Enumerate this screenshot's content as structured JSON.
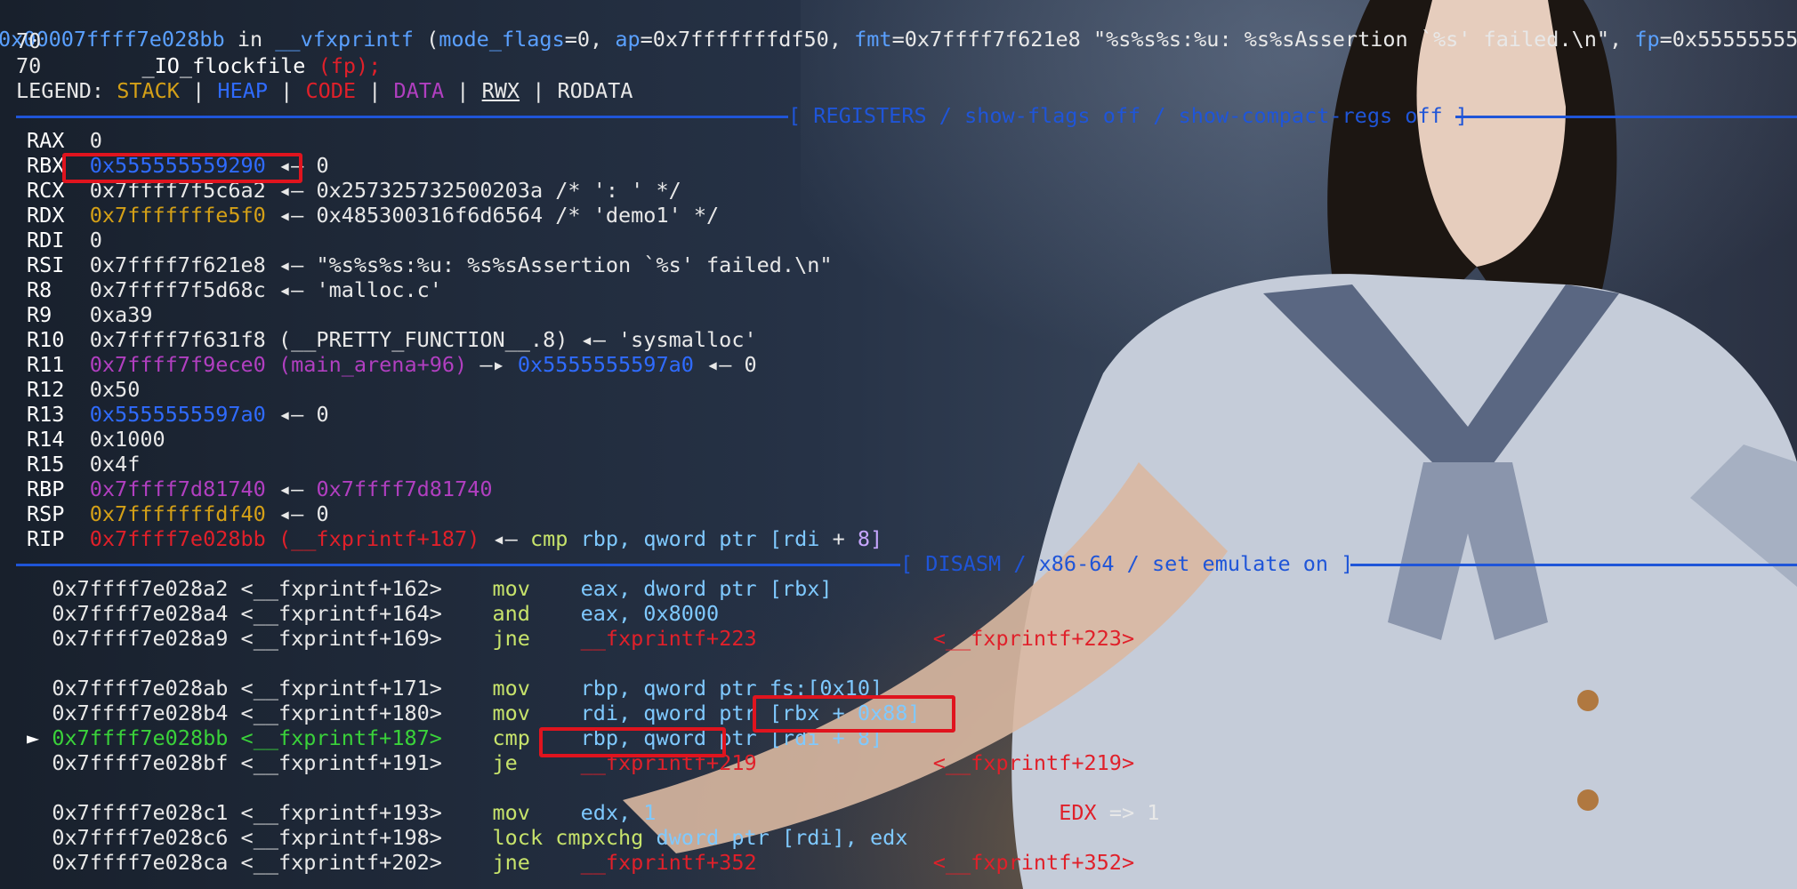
{
  "frame": {
    "addr": "0x00007ffff7e028bb",
    "in_word": "in",
    "func": "__vfxprintf",
    "args_open": "(",
    "arg1_name": "mode_flags",
    "arg1_val": "=0, ",
    "arg2_name": "ap",
    "arg2_val": "=0x7fffffffdf50, ",
    "arg3_name": "fmt",
    "arg3_val": "=0x7ffff7f621e8 \"%s%s%s:%u: %s%sAssertion `%s' failed.\\n\", ",
    "arg4_name": "fp",
    "arg4_val": "=0x55555555"
  },
  "source": {
    "line1": "70",
    "line2_no": "70",
    "line2_code": "_IO_flockfile",
    "line2_args": "(fp);"
  },
  "legend": {
    "label": "LEGEND:",
    "stack": "STACK",
    "heap": "HEAP",
    "code": "CODE",
    "data": "DATA",
    "rwx": "RWX",
    "rodata": "RODATA",
    "bar": "|"
  },
  "headers": {
    "registers": "[ REGISTERS / show-flags off / show-compact-regs off ]",
    "disasm": "[ DISASM / x86-64 / set emulate on ]"
  },
  "registers": [
    {
      "name": "RAX",
      "v1": "0",
      "arrow": "",
      "v2": ""
    },
    {
      "name": "RBX",
      "v1": "0x555555559290",
      "arrow": "◂—",
      "v2": "0"
    },
    {
      "name": "RCX",
      "v1": "0x7ffff7f5c6a2",
      "arrow": "◂—",
      "v2": "0x257325732500203a /* ': ' */"
    },
    {
      "name": "RDX",
      "v1": "0x7fffffffe5f0",
      "arrow": "◂—",
      "v2": "0x485300316f6d6564 /* 'demo1' */"
    },
    {
      "name": "RDI",
      "v1": "0",
      "arrow": "",
      "v2": ""
    },
    {
      "name": "RSI",
      "v1": "0x7ffff7f621e8",
      "arrow": "◂—",
      "v2": "\"%s%s%s:%u: %s%sAssertion `%s' failed.\\n\""
    },
    {
      "name": "R8",
      "v1": "0x7ffff7f5d68c",
      "arrow": "◂—",
      "v2": "'malloc.c'"
    },
    {
      "name": "R9",
      "v1": "0xa39",
      "arrow": "",
      "v2": ""
    },
    {
      "name": "R10",
      "v1": "0x7ffff7f631f8 (__PRETTY_FUNCTION__.8)",
      "arrow": "◂—",
      "v2": "'sysmalloc'"
    },
    {
      "name": "R11",
      "v1": "0x7ffff7f9ece0 (main_arena+96)",
      "arrow": "—▸",
      "v2": "0x5555555597a0",
      "arrow2": "◂—",
      "v3": "0"
    },
    {
      "name": "R12",
      "v1": "0x50",
      "arrow": "",
      "v2": ""
    },
    {
      "name": "R13",
      "v1": "0x5555555597a0",
      "arrow": "◂—",
      "v2": "0"
    },
    {
      "name": "R14",
      "v1": "0x1000",
      "arrow": "",
      "v2": ""
    },
    {
      "name": "R15",
      "v1": "0x4f",
      "arrow": "",
      "v2": ""
    },
    {
      "name": "RBP",
      "v1": "0x7ffff7d81740",
      "arrow": "◂—",
      "v2": "0x7ffff7d81740"
    },
    {
      "name": "RSP",
      "v1": "0x7fffffffdf40",
      "arrow": "◂—",
      "v2": "0"
    },
    {
      "name": "RIP",
      "v1": "0x7ffff7e028bb (__fxprintf+187)",
      "arrow": "◂—",
      "v2": "cmp",
      "v3": "rbp,",
      "v4": "qword ptr",
      "v5": "[rdi",
      "v6": "+",
      "v7": "8]"
    }
  ],
  "disasm": [
    {
      "addr": "0x7ffff7e028a2",
      "sym": "<__fxprintf+162>",
      "mnem": "mov",
      "ops": "eax, dword ptr [rbx]"
    },
    {
      "addr": "0x7ffff7e028a4",
      "sym": "<__fxprintf+164>",
      "mnem": "and",
      "ops": "eax, 0x8000"
    },
    {
      "addr": "0x7ffff7e028a9",
      "sym": "<__fxprintf+169>",
      "mnem": "jne",
      "ops": "__fxprintf+223",
      "target": "<__fxprintf+223>"
    },
    {
      "addr": "0x7ffff7e028ab",
      "sym": "<__fxprintf+171>",
      "mnem": "mov",
      "ops": "rbp, qword ptr fs:[0x10]"
    },
    {
      "addr": "0x7ffff7e028b4",
      "sym": "<__fxprintf+180>",
      "mnem": "mov",
      "ops": "rdi, qword ptr [rbx + 0x88]"
    },
    {
      "addr": "0x7ffff7e028bb",
      "sym": "<__fxprintf+187>",
      "mnem": "cmp",
      "ops": "rbp, qword ptr [rdi + 8]",
      "marker": "►"
    },
    {
      "addr": "0x7ffff7e028bf",
      "sym": "<__fxprintf+191>",
      "mnem": "je",
      "ops": "__fxprintf+219",
      "target": "<__fxprintf+219>"
    },
    {
      "addr": "0x7ffff7e028c1",
      "sym": "<__fxprintf+193>",
      "mnem": "mov",
      "ops": "edx, 1",
      "note_reg": "EDX",
      "note": "=> 1"
    },
    {
      "addr": "0x7ffff7e028c6",
      "sym": "<__fxprintf+198>",
      "mnem": "lock cmpxchg",
      "ops": "dword ptr [rdi], edx"
    },
    {
      "addr": "0x7ffff7e028ca",
      "sym": "<__fxprintf+202>",
      "mnem": "jne",
      "ops": "__fxprintf+352",
      "target": "<__fxprintf+352>"
    }
  ]
}
